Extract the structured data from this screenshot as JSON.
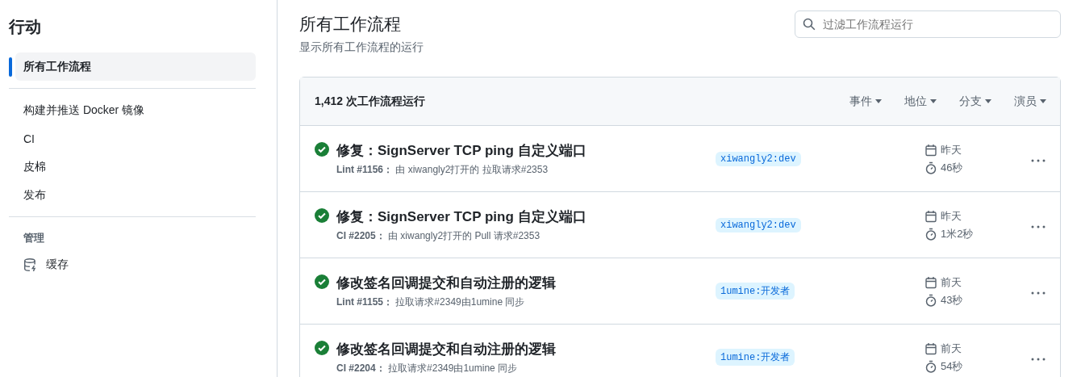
{
  "sidebar": {
    "title": "行动",
    "items": [
      {
        "label": "所有工作流程",
        "selected": true
      }
    ],
    "workflows": [
      {
        "label": "构建并推送 Docker 镜像",
        "selected": false
      },
      {
        "label": "CI",
        "selected": false
      },
      {
        "label": "皮棉",
        "selected": false
      },
      {
        "label": "发布",
        "selected": false
      }
    ],
    "management": {
      "heading": "管理",
      "items": [
        {
          "label": "缓存",
          "selected": false
        }
      ]
    }
  },
  "header": {
    "title": "所有工作流程",
    "subtitle": "显示所有工作流程的运行",
    "search": {
      "placeholder": "过滤工作流程运行"
    }
  },
  "runs": {
    "count": "1,412 次工作流程运行",
    "filters": [
      "事件",
      "地位",
      "分支",
      "演员"
    ],
    "rows": [
      {
        "succeeded": true,
        "title": "修复：SignServer TCP ping 自定义端口",
        "meta": "**Lint #1156：** 由 xiwangly2打开的 拉取请求#2353",
        "branch": "xiwangly2:dev",
        "date": "昨天",
        "duration": "46秒"
      },
      {
        "succeeded": true,
        "title": "修复：SignServer TCP ping 自定义端口",
        "meta": "**CI #2205：** 由 xiwangly2打开的 Pull 请求#2353",
        "branch": "xiwangly2:dev",
        "date": "昨天",
        "duration": "1米2秒"
      },
      {
        "succeeded": true,
        "title": "修改签名回调提交和自动注册的逻辑",
        "meta": "**Lint #1155：** 拉取请求#2349由1umine 同步",
        "branch": "1umine:开发者",
        "date": "前天",
        "duration": "43秒"
      },
      {
        "succeeded": true,
        "title": "修改签名回调提交和自动注册的逻辑",
        "meta": "**CI #2204：** 拉取请求#2349由1umine 同步",
        "branch": "1umine:开发者",
        "date": "前天",
        "duration": "54秒"
      }
    ]
  }
}
